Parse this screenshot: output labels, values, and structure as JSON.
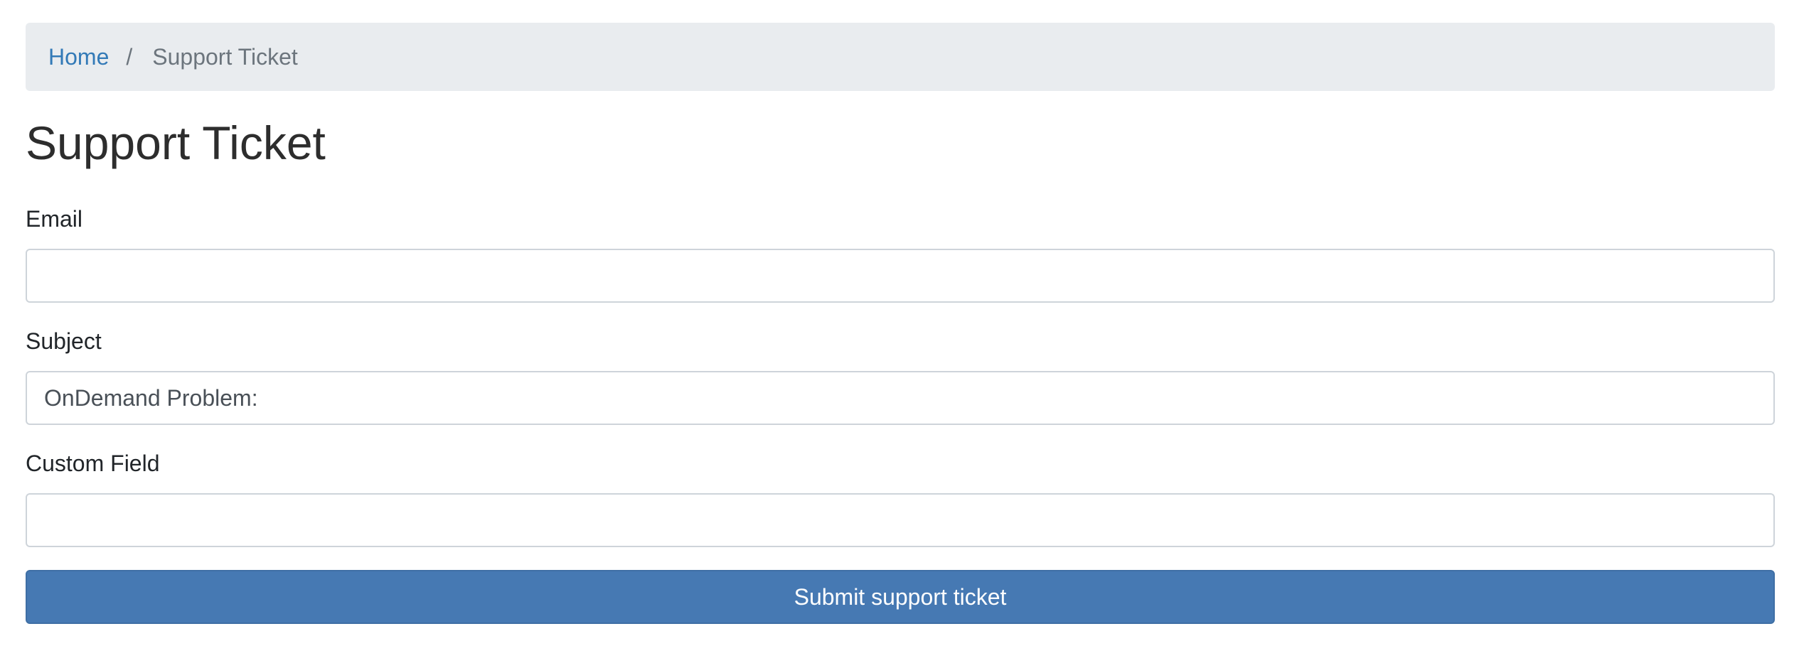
{
  "breadcrumb": {
    "home_label": "Home",
    "separator": "/",
    "current_label": "Support Ticket"
  },
  "page": {
    "title": "Support Ticket"
  },
  "form": {
    "email": {
      "label": "Email",
      "value": ""
    },
    "subject": {
      "label": "Subject",
      "value": "OnDemand Problem:"
    },
    "custom_field": {
      "label": "Custom Field",
      "value": ""
    },
    "submit_label": "Submit support ticket"
  },
  "colors": {
    "link": "#337ab7",
    "button": "#4679b3",
    "breadcrumb_bg": "#e9ecef"
  }
}
